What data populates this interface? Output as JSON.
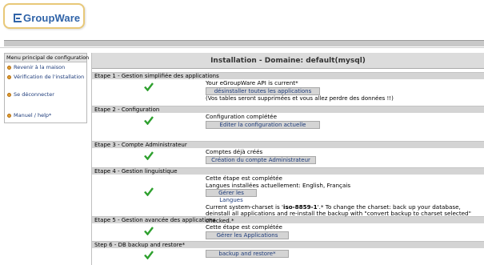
{
  "app": {
    "logo_text": "GroupWare"
  },
  "sidebar": {
    "title": "Menu principal de configuration",
    "items": [
      {
        "label": "Revenir à la maison",
        "icon": "bullet-icon"
      },
      {
        "label": "Vérification de l'installation",
        "icon": "bullet-icon"
      },
      {
        "label": "Se déconnecter",
        "icon": "bullet-icon"
      },
      {
        "label": "Manuel / help*",
        "icon": "bullet-icon"
      }
    ]
  },
  "main": {
    "title": "Installation - Domaine: default(mysql)",
    "steps": [
      {
        "header": "Etape 1 - Gestion simplifiée des applications",
        "status": "check-icon",
        "lines": [
          "Your eGroupWare API is current*"
        ],
        "button": "désinstaller toutes les applications",
        "note": "(Vos tables seront supprimées et vous allez perdre des données !!)"
      },
      {
        "header": "Etape 2 - Configuration",
        "status": "check-icon",
        "lines": [
          "Configuration complétée"
        ],
        "button": "Editer la configuration actuelle"
      },
      {
        "header": "Etape 3 - Compte Administrateur",
        "status": "check-icon",
        "lines": [
          "Comptes déjà créés"
        ],
        "button": "Création du compte Administrateur"
      },
      {
        "header": "Etape 4 - Gestion linguistique",
        "status": "check-icon",
        "lines": [
          "Cette étape est complétée",
          "Langues installées actuellement: English, Français"
        ],
        "button": "Gérer les Langues",
        "charset_prefix": "Current system-charset is '",
        "charset_value": "iso-8859-1",
        "charset_suffix": "'.* To change the charset: back up your database, deinstall all applications and re-install the backup with \"convert backup to charset selected\" checked.*"
      },
      {
        "header": "Etape 5 - Gestion avancée des applications",
        "status": "check-icon",
        "lines": [
          "Cette étape est complétée"
        ],
        "button": "Gérer les Applications"
      },
      {
        "header": "Step 6 - DB backup and restore*",
        "status": "check-icon",
        "button": "backup and restore*"
      }
    ]
  },
  "colors": {
    "check": "#2ea02e",
    "link": "#1d3b7a",
    "logo": "#2f63a8"
  }
}
